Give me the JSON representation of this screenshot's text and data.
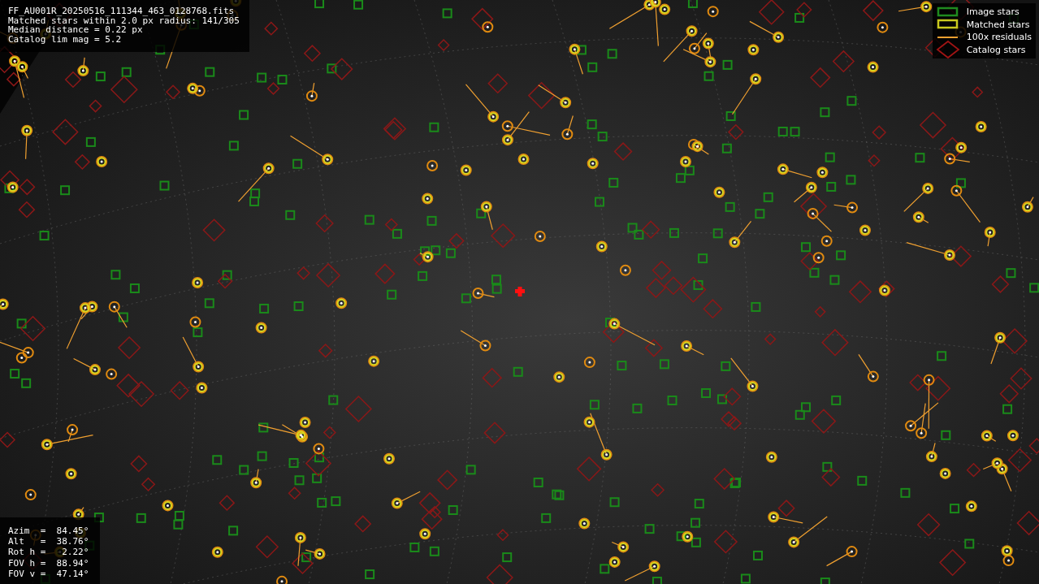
{
  "info": {
    "lines": [
      "FF_AU001R_20250516_111344_463_0128768.fits",
      "Matched stars within 2.0 px radius: 141/305",
      "Median distance = 0.22 px",
      "Catalog lim mag = 5.2"
    ]
  },
  "legend": [
    {
      "kind": "box",
      "label": "Image stars",
      "color": "#1f8a1f"
    },
    {
      "kind": "box",
      "label": "Matched stars",
      "color": "#c8c81e"
    },
    {
      "kind": "line",
      "label": "100x residuals",
      "color": "#f0a030"
    },
    {
      "kind": "diamond",
      "label": "Catalog stars",
      "color": "#a01414"
    }
  ],
  "pointing": {
    "lines": [
      "Azim  =  84.45°",
      "Alt   =  38.76°",
      "Rot h =   2.22°",
      "FOV h =  88.94°",
      "FOV v =  47.14°"
    ]
  }
}
